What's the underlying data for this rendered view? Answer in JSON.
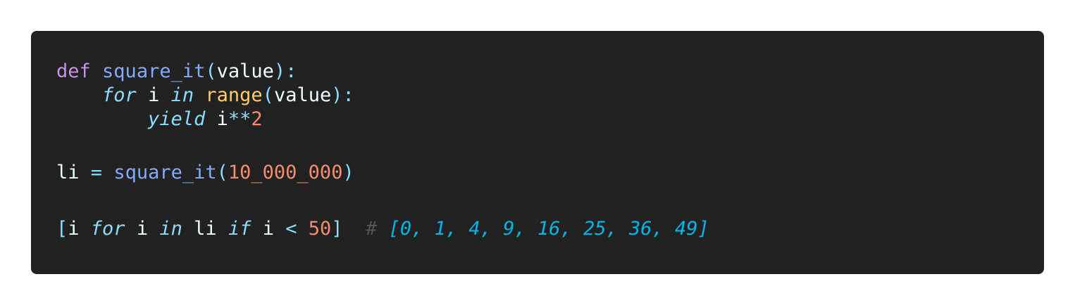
{
  "code": {
    "line1": {
      "kw": "def",
      "name": "square_it",
      "open": "(",
      "param": "value",
      "close": "):"
    },
    "line2": {
      "indent": "    ",
      "kw_for": "for",
      "var": "i",
      "kw_in": "in",
      "builtin": "range",
      "open": "(",
      "arg": "value",
      "close": "):"
    },
    "line3": {
      "indent": "        ",
      "kw_yield": "yield",
      "var": "i",
      "op": "**",
      "num": "2"
    },
    "line5": {
      "var": "li",
      "eq": "=",
      "call": "square_it",
      "open": "(",
      "num": "10_000_000",
      "close": ")"
    },
    "line7": {
      "open": "[",
      "var1": "i",
      "kw_for": "for",
      "var2": "i",
      "kw_in": "in",
      "iter": "li",
      "kw_if": "if",
      "var3": "i",
      "lt": "<",
      "num": "50",
      "close": "]",
      "comment_mark": "#",
      "comment_text": "[0, 1, 4, 9, 16, 25, 36, 49]"
    }
  },
  "colors": {
    "background": "#212121",
    "keyword": "#c792ea",
    "function": "#82aaff",
    "punctuation": "#89ddff",
    "builtin": "#ffcb6b",
    "number": "#f78c6c",
    "text": "#eeffff",
    "comment": "#00b7e8"
  }
}
